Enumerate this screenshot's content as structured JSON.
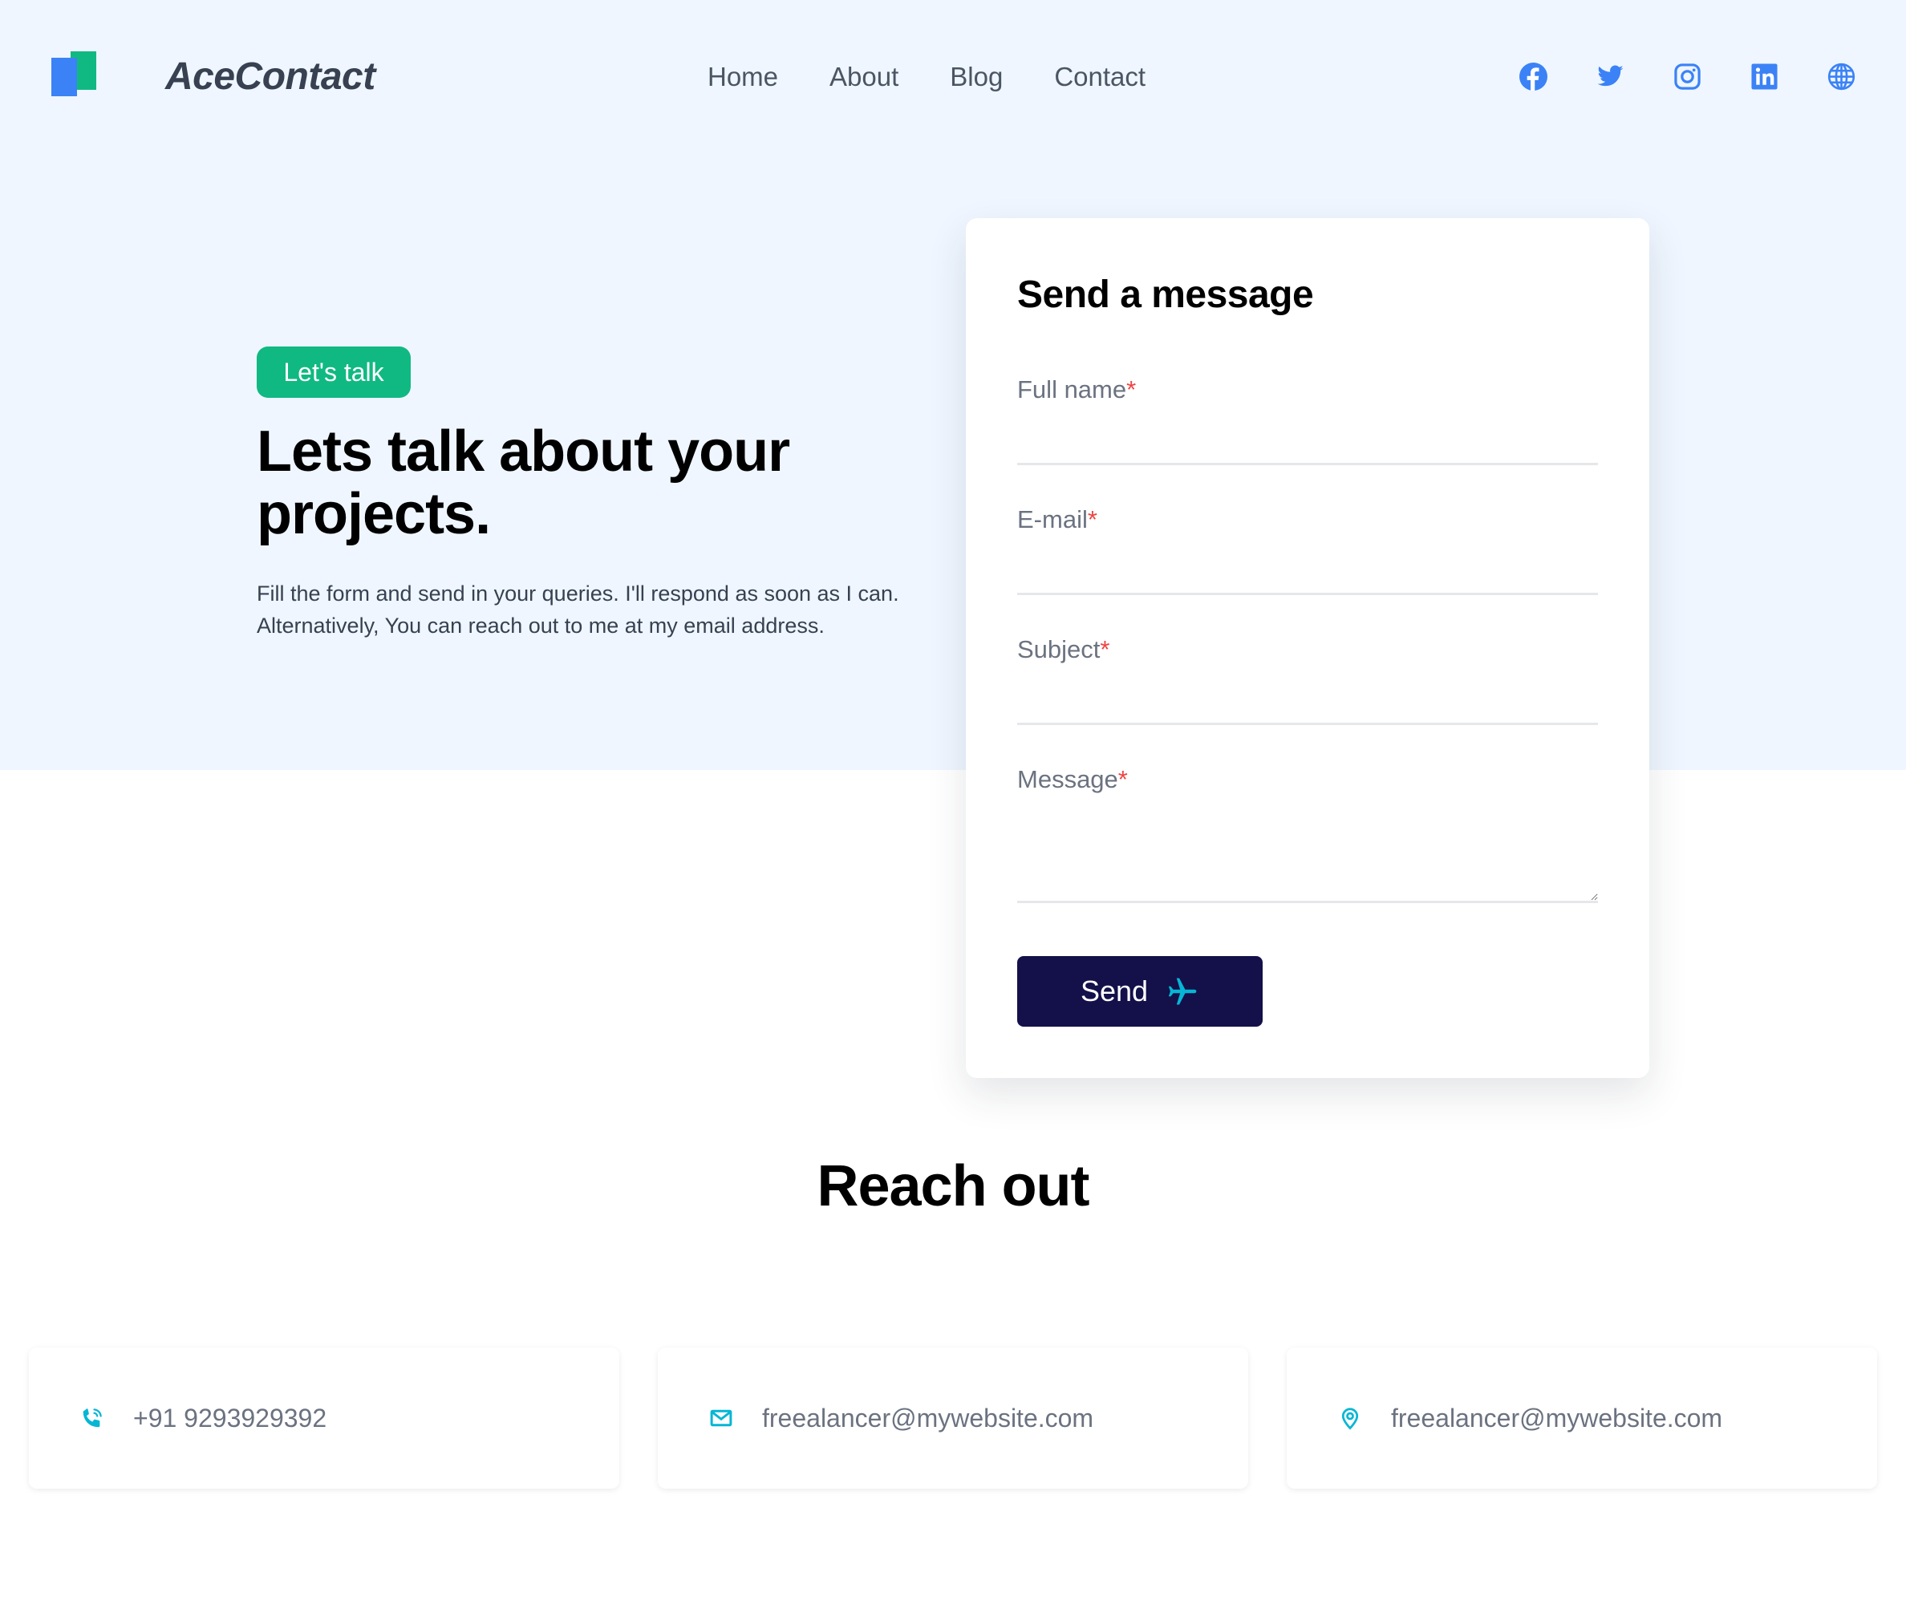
{
  "header": {
    "brand": "AceContact",
    "nav": [
      {
        "label": "Home"
      },
      {
        "label": "About"
      },
      {
        "label": "Blog"
      },
      {
        "label": "Contact"
      }
    ],
    "social": [
      "facebook-icon",
      "twitter-icon",
      "instagram-icon",
      "linkedin-icon",
      "globe-icon"
    ]
  },
  "hero": {
    "badge": "Let's talk",
    "title": "Lets talk about your projects.",
    "description": "Fill the form and send in your queries. I'll respond as soon as I can. Alternatively, You can reach out to me at my email address."
  },
  "form": {
    "title": "Send a message",
    "fields": [
      {
        "label": "Full name",
        "required_mark": "*",
        "value": ""
      },
      {
        "label": "E-mail",
        "required_mark": "*",
        "value": ""
      },
      {
        "label": "Subject",
        "required_mark": "*",
        "value": ""
      },
      {
        "label": "Message",
        "required_mark": "*",
        "value": ""
      }
    ],
    "submit_label": "Send"
  },
  "reach_out": {
    "title": "Reach out",
    "items": [
      {
        "icon": "phone-icon",
        "text": "+91 9293929392"
      },
      {
        "icon": "mail-icon",
        "text": "freealancer@mywebsite.com"
      },
      {
        "icon": "location-pin-icon",
        "text": "freealancer@mywebsite.com"
      }
    ]
  },
  "colors": {
    "hero_bg": "#eff6ff",
    "brand_blue": "#3b82f6",
    "brand_green": "#10b981",
    "button_bg": "#14104a",
    "accent_cyan": "#06b6d4",
    "required": "#ef4444"
  }
}
